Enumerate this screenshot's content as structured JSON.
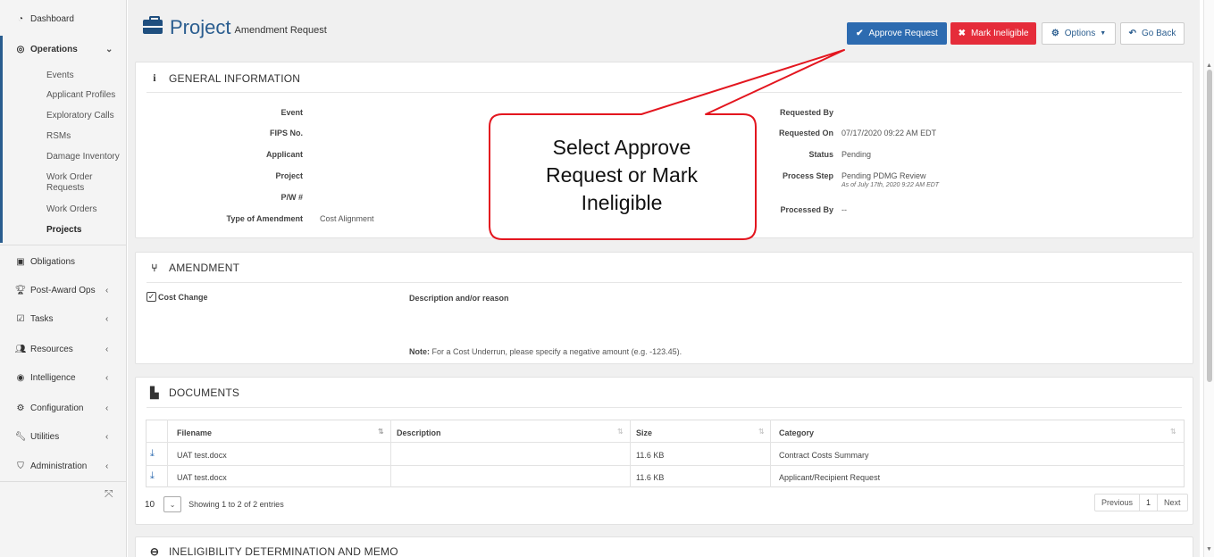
{
  "sidebar": {
    "dashboard": "Dashboard",
    "operations": "Operations",
    "operations_items": [
      "Events",
      "Applicant Profiles",
      "Exploratory Calls",
      "RSMs",
      "Damage Inventory",
      "Work Order",
      "Requests",
      "Work Orders",
      "Projects"
    ],
    "obligations": "Obligations",
    "post_award": "Post-Award Ops",
    "tasks": "Tasks",
    "resources": "Resources",
    "intelligence": "Intelligence",
    "configuration": "Configuration",
    "utilities": "Utilities",
    "administration": "Administration"
  },
  "header": {
    "title": "Project",
    "subtitle": "Amendment Request",
    "approve": "Approve Request",
    "ineligible": "Mark Ineligible",
    "options": "Options",
    "back": "Go Back"
  },
  "general": {
    "heading": "GENERAL INFORMATION",
    "left_labels": [
      "Event",
      "FIPS No.",
      "Applicant",
      "Project",
      "P/W #",
      "Type of Amendment"
    ],
    "type_of_amendment": "Cost Alignment",
    "right_labels": [
      "Requested By",
      "Requested On",
      "Status",
      "Process Step",
      "Processed By"
    ],
    "requested_on": "07/17/2020 09:22 AM EDT",
    "status": "Pending",
    "process_step": "Pending PDMG Review",
    "process_step_note": "As of July 17th, 2020 9:22 AM EDT",
    "processed_by": "--"
  },
  "amendment": {
    "heading": "AMENDMENT",
    "cost_change": "Cost Change",
    "desc_label": "Description and/or reason",
    "note_label": "Note:",
    "note_text": "For a Cost Underrun, please specify a negative amount (e.g. -123.45)."
  },
  "documents": {
    "heading": "DOCUMENTS",
    "columns": [
      "Filename",
      "Description",
      "Size",
      "Category"
    ],
    "rows": [
      {
        "filename": "UAT test.docx",
        "description": "",
        "size": "11.6 KB",
        "category": "Contract Costs Summary"
      },
      {
        "filename": "UAT test.docx",
        "description": "",
        "size": "11.6 KB",
        "category": "Applicant/Recipient Request"
      }
    ],
    "page_size": "10",
    "showing": "Showing 1 to 2 of 2 entries",
    "prev": "Previous",
    "page": "1",
    "next": "Next"
  },
  "ineligibility": {
    "heading": "INELIGIBILITY DETERMINATION AND MEMO"
  },
  "callout": {
    "lines": [
      "Select Approve",
      "Request or Mark",
      "Ineligible"
    ],
    "color": "#e3161f"
  },
  "colors": {
    "primary": "#2d6bb0",
    "danger": "#e52c3a",
    "title": "#2a5d8f"
  }
}
